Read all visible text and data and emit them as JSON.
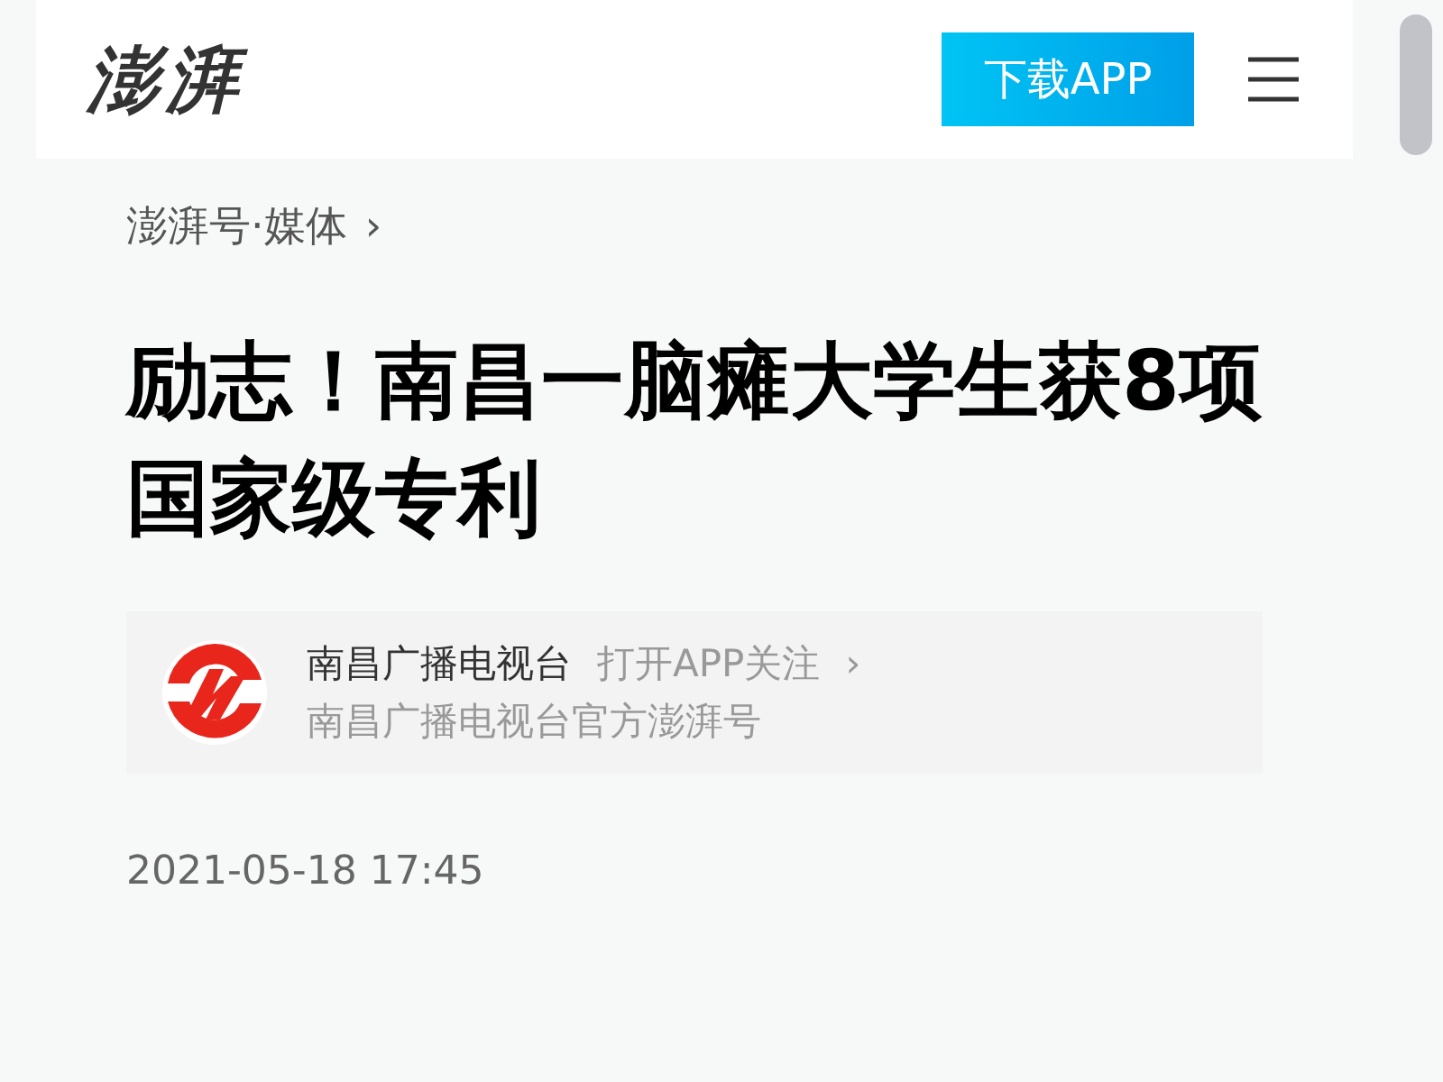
{
  "header": {
    "logo": "澎湃",
    "download_button": "下载APP"
  },
  "breadcrumb": {
    "label": "澎湃号·媒体",
    "chevron": "›"
  },
  "article": {
    "title": "励志！南昌一脑瘫大学生获8项国家级专利"
  },
  "author": {
    "name": "南昌广播电视台",
    "follow": "打开APP关注",
    "chevron": "›",
    "description": "南昌广播电视台官方澎湃号"
  },
  "date": "2021-05-18 17:45"
}
